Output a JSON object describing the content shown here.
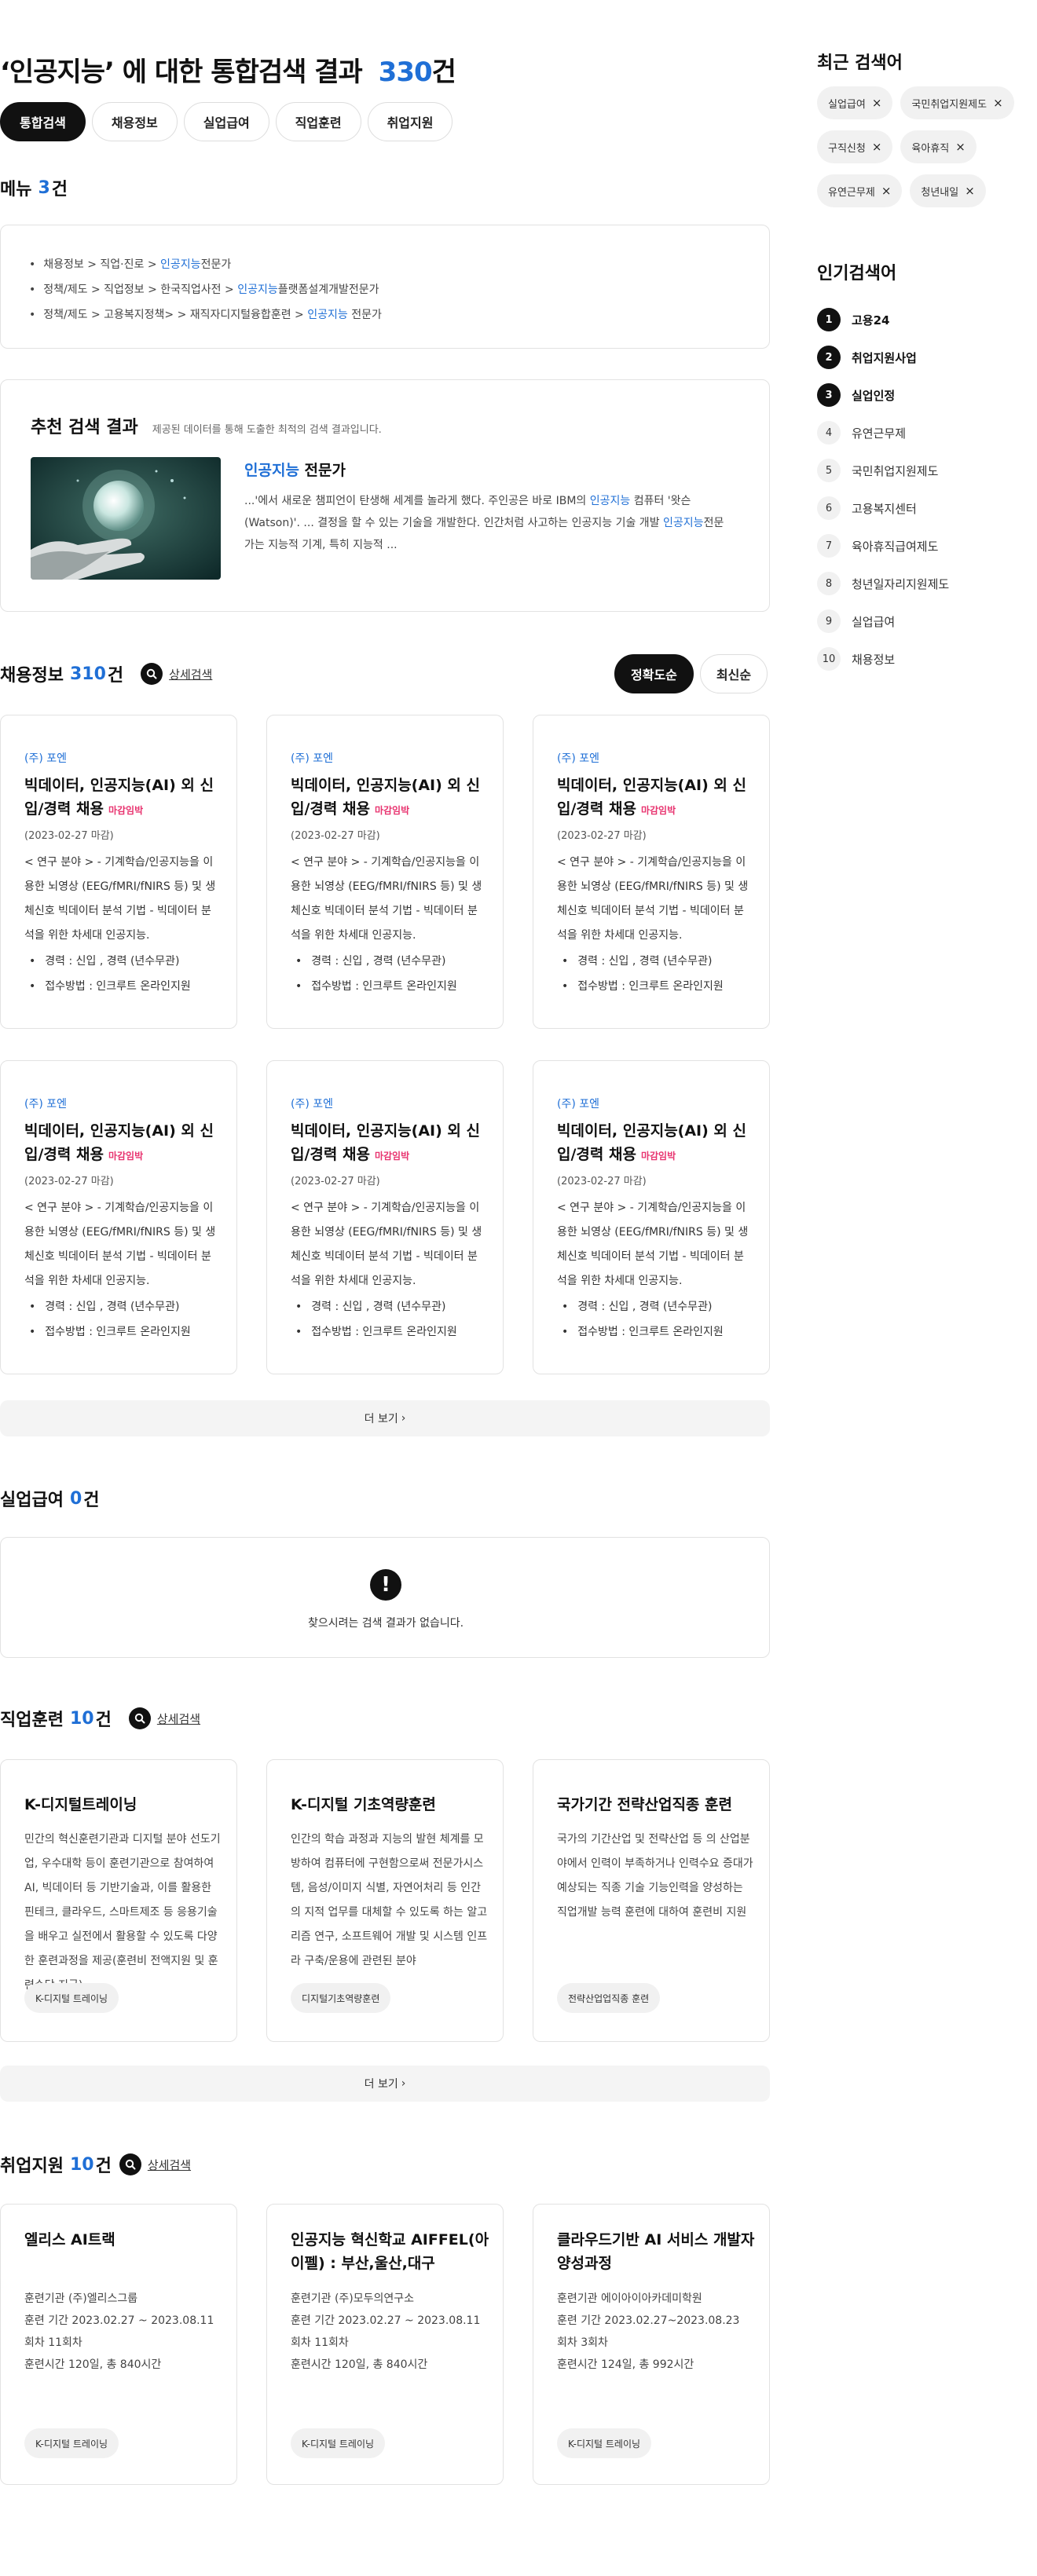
{
  "header": {
    "title_quote": "‘인공지능’ 에 대한 통합검색 결과",
    "title_count": "330",
    "title_unit": "건"
  },
  "tabs": [
    "통합검색",
    "채용정보",
    "실업급여",
    "직업훈련",
    "취업지원"
  ],
  "menu_section": {
    "title": "메뉴",
    "count": "3",
    "unit": "건",
    "items": [
      {
        "pre": "채용정보 > 직업·진로 > ",
        "hl": "인공지능",
        "post": "전문가"
      },
      {
        "pre": "정책/제도 > 직업정보 > 한국직업사전 > ",
        "hl": "인공지능",
        "post": "플랫폼설계개발전문가"
      },
      {
        "pre": "정책/제도 > 고용복지정책> > 재직자디지털융합훈련 > ",
        "hl": "인공지능",
        "post": " 전문가"
      }
    ]
  },
  "recommend": {
    "title": "추천 검색 결과",
    "subtitle": "제공된 데이터를 통해 도출한 최적의 검색 결과입니다.",
    "link_hl": "인공지능",
    "link_rest": " 전문가",
    "desc_1": "...'에서 새로운 챔피언이 탄생해 세계를 놀라게 했다. 주인공은 바로 IBM의 ",
    "desc_hl1": "인공지능",
    "desc_2": " 컴퓨터 '왓슨(Watson)'. ... 결정을 할 수 있는 기술을 개발한다. 인간처럼 사고하는 인공지능 기술 개발 ",
    "desc_hl2": "인공지능",
    "desc_3": "전문가는 지능적 기계, 특히 지능적 ..."
  },
  "jobs": {
    "title": "채용정보",
    "count": "310",
    "unit": "건",
    "detail_search": "상세검색",
    "sort": [
      "정확도순",
      "최신순"
    ],
    "cards": [
      {
        "company": "(주) 포엔",
        "title": "빅데이터, 인공지능(AI) 외 신입/경력 채용",
        "badge": "마감임박",
        "date": "(2023-02-27 마감)",
        "desc": "< 연구 분야 > - 기계학습/인공지능을 이용한 뇌영상 (EEG/fMRI/fNIRS 등) 및 생체신호 빅데이터 분석 기법 - 빅데이터 분석을 위한 차세대 인공지능.",
        "career": "경력 : 신입 , 경력 (년수무관)",
        "apply": "접수방법 : 인크루트 온라인지원"
      },
      {
        "company": "(주) 포엔",
        "title": "빅데이터, 인공지능(AI) 외 신입/경력 채용",
        "badge": "마감임박",
        "date": "(2023-02-27 마감)",
        "desc": "< 연구 분야 > - 기계학습/인공지능을 이용한 뇌영상 (EEG/fMRI/fNIRS 등) 및 생체신호 빅데이터 분석 기법 - 빅데이터 분석을 위한 차세대 인공지능.",
        "career": "경력 : 신입 , 경력 (년수무관)",
        "apply": "접수방법 : 인크루트 온라인지원"
      },
      {
        "company": "(주) 포엔",
        "title": "빅데이터, 인공지능(AI) 외 신입/경력 채용",
        "badge": "마감임박",
        "date": "(2023-02-27 마감)",
        "desc": "< 연구 분야 > - 기계학습/인공지능을 이용한 뇌영상 (EEG/fMRI/fNIRS 등) 및 생체신호 빅데이터 분석 기법 - 빅데이터 분석을 위한 차세대 인공지능.",
        "career": "경력 : 신입 , 경력 (년수무관)",
        "apply": "접수방법 : 인크루트 온라인지원"
      },
      {
        "company": "(주) 포엔",
        "title": "빅데이터, 인공지능(AI) 외 신입/경력 채용",
        "badge": "마감임박",
        "date": "(2023-02-27 마감)",
        "desc": "< 연구 분야 > - 기계학습/인공지능을 이용한 뇌영상 (EEG/fMRI/fNIRS 등) 및 생체신호 빅데이터 분석 기법 - 빅데이터 분석을 위한 차세대 인공지능.",
        "career": "경력 : 신입 , 경력 (년수무관)",
        "apply": "접수방법 : 인크루트 온라인지원"
      },
      {
        "company": "(주) 포엔",
        "title": "빅데이터, 인공지능(AI) 외 신입/경력 채용",
        "badge": "마감임박",
        "date": "(2023-02-27 마감)",
        "desc": "< 연구 분야 > - 기계학습/인공지능을 이용한 뇌영상 (EEG/fMRI/fNIRS 등) 및 생체신호 빅데이터 분석 기법 - 빅데이터 분석을 위한 차세대 인공지능.",
        "career": "경력 : 신입 , 경력 (년수무관)",
        "apply": "접수방법 : 인크루트 온라인지원"
      },
      {
        "company": "(주) 포엔",
        "title": "빅데이터, 인공지능(AI) 외 신입/경력 채용",
        "badge": "마감임박",
        "date": "(2023-02-27 마감)",
        "desc": "< 연구 분야 > - 기계학습/인공지능을 이용한 뇌영상 (EEG/fMRI/fNIRS 등) 및 생체신호 빅데이터 분석 기법 - 빅데이터 분석을 위한 차세대 인공지능.",
        "career": "경력 : 신입 , 경력 (년수무관)",
        "apply": "접수방법 : 인크루트 온라인지원"
      }
    ],
    "more": "더 보기"
  },
  "unemployment": {
    "title": "실업급여",
    "count": "0",
    "unit": "건",
    "empty_text": "찾으시려는 검색 결과가 없습니다."
  },
  "training": {
    "title": "직업훈련",
    "count": "10",
    "unit": "건",
    "detail_search": "상세검색",
    "cards": [
      {
        "title": "K-디지털트레이닝",
        "desc": "민간의 혁신훈련기관과 디지털 분야 선도기업, 우수대학 등이 훈련기관으로 참여하여 AI, 빅데이터 등 기반기술과, 이를 활용한 핀테크, 클라우드, 스마트제조 등 응용기술을 배우고 실전에서 활용할 수 있도록 다양한 훈련과정을 제공(훈련비 전액지원 및 훈련수당 지급)",
        "chip": "K-디지털 트레이닝"
      },
      {
        "title": "K-디지털 기초역량훈련",
        "desc": "인간의 학습 과정과 지능의 발현 체계를 모방하여 컴퓨터에 구현함으로써 전문가시스템, 음성/이미지 식별, 자연어처리 등 인간의 지적 업무를 대체할 수 있도록 하는 알고리즘 연구, 소프트웨어 개발 및 시스템 인프라 구축/운용에 관련된 분야",
        "chip": "디지털기초역량훈련"
      },
      {
        "title": "국가기간 전략산업직종 훈련",
        "desc": "국가의 기간산업 및 전략산업 등 의 산업분야에서 인력이 부족하거나 인력수요 증대가 예상되는 직종 기술 기능인력을 양성하는 직업개발 능력 훈련에 대하여 훈련비 지원",
        "chip": "전략산업업직종 훈련"
      }
    ],
    "more": "더 보기"
  },
  "support": {
    "title": "취업지원",
    "count": "10",
    "unit": "건",
    "detail_search": "상세검색",
    "cards": [
      {
        "title": "엘리스 AI트랙",
        "info": [
          "훈련기관 (주)엘리스그룹",
          "훈련 기간 2023.02.27 ~ 2023.08.11",
          "회차 11회차",
          "훈련시간 120일, 총 840시간"
        ],
        "chip": "K-디지털 트레이닝"
      },
      {
        "title": "인공지능 혁신학교 AIFFEL(아이펠) : 부산,울산,대구",
        "info": [
          "훈련기관 (주)모두의연구소",
          "훈련 기간 2023.02.27 ~ 2023.08.11",
          "회차 11회차",
          "훈련시간 120일, 총 840시간"
        ],
        "chip": "K-디지털 트레이닝"
      },
      {
        "title": "클라우드기반 AI 서비스 개발자 양성과정",
        "info": [
          "훈련기관 에이아이아카데미학원",
          "훈련 기간 2023.02.27~2023.08.23",
          "회차 3회차",
          "훈련시간 124일, 총 992시간"
        ],
        "chip": "K-디지털 트레이닝"
      }
    ]
  },
  "sidebar": {
    "recent_title": "최근 검색어",
    "recent": [
      "실업급여",
      "국민취업지원제도",
      "구직신청",
      "육아휴직",
      "유연근무제",
      "청년내일"
    ],
    "popular_title": "인기검색어",
    "popular": [
      "고용24",
      "취업지원사업",
      "실업인정",
      "유연근무제",
      "국민취업지원제도",
      "고용복지센터",
      "육아휴직급여제도",
      "청년일자리지원제도",
      "실업급여",
      "채용정보"
    ]
  },
  "colors": {
    "accent": "#1f6fd6",
    "deadline": "#e8336f",
    "dark": "#111111"
  }
}
